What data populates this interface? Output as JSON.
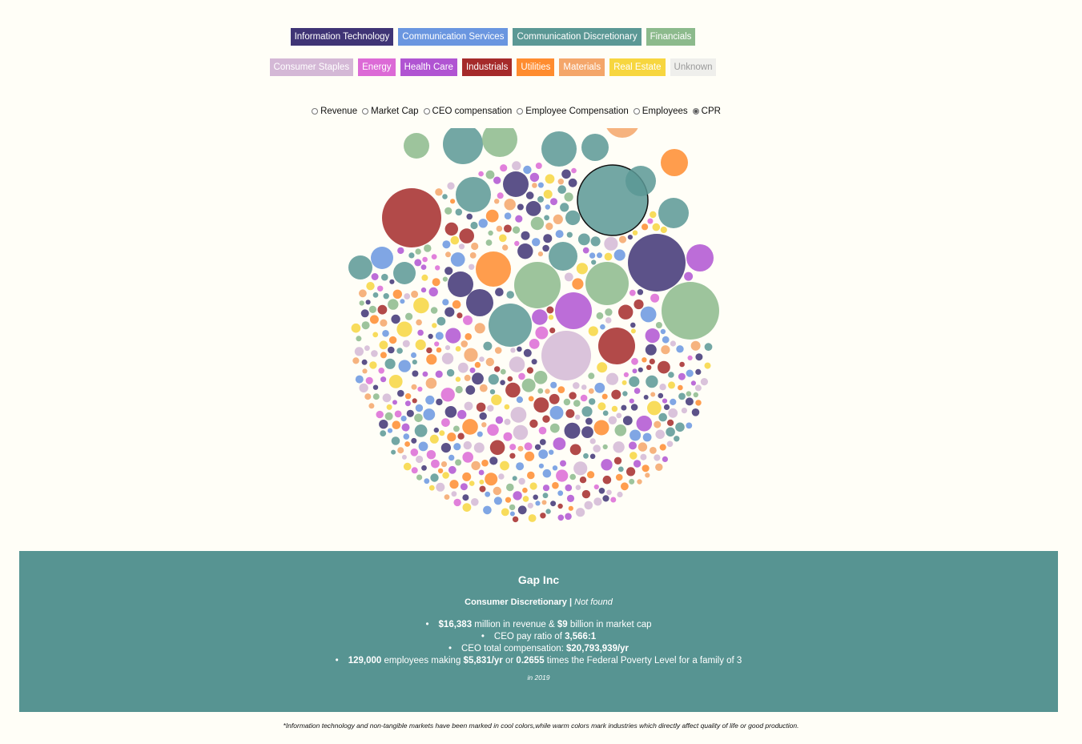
{
  "legend": {
    "row1": [
      {
        "label": "Information Technology",
        "color": "#3f3475"
      },
      {
        "label": "Communication Services",
        "color": "#6a96e0"
      },
      {
        "label": "Communication Discretionary",
        "color": "#5b9895"
      },
      {
        "label": "Financials",
        "color": "#8cba8c"
      }
    ],
    "row2": [
      {
        "label": "Consumer Staples",
        "color": "#d4b8d6"
      },
      {
        "label": "Energy",
        "color": "#dc6ad6"
      },
      {
        "label": "Health Care",
        "color": "#b054d2"
      },
      {
        "label": "Industrials",
        "color": "#a52a2a"
      },
      {
        "label": "Utilities",
        "color": "#ff8c2f"
      },
      {
        "label": "Materials",
        "color": "#f4a66a"
      },
      {
        "label": "Real Estate",
        "color": "#f7d63f"
      },
      {
        "label": "Unknown",
        "color": "#efefec",
        "text_color": "#9a9a9a"
      }
    ]
  },
  "radios": [
    {
      "label": "Revenue",
      "checked": false
    },
    {
      "label": "Market Cap",
      "checked": false
    },
    {
      "label": "CEO compensation",
      "checked": false
    },
    {
      "label": "Employee Compensation",
      "checked": false
    },
    {
      "label": "Employees",
      "checked": false
    },
    {
      "label": "CPR",
      "checked": true
    }
  ],
  "panel": {
    "company": "Gap Inc",
    "sector": "Consumer Discretionary",
    "separator": " | ",
    "status": "Not found",
    "revenue_line": {
      "v1": "$16,383",
      "t1": " million in revenue & ",
      "v2": "$9",
      "t2": " billion in market cap"
    },
    "ratio_line": {
      "t1": "CEO pay ratio of ",
      "v1": "3,566:1"
    },
    "comp_line": {
      "t1": "CEO total compensation: ",
      "v1": "$20,793,939/yr"
    },
    "emp_line": {
      "v1": "129,000",
      "t1": " employees making ",
      "v2": "$5,831/yr",
      "t2": " or ",
      "v3": "0.2655",
      "t3": " times the Federal Poverty Level for a family of 3"
    },
    "year": "in 2019"
  },
  "footnote": "*Information technology and non-tangible markets have been marked in cool colors,while warm colors mark industries which directly affect quality of life or good production."
}
